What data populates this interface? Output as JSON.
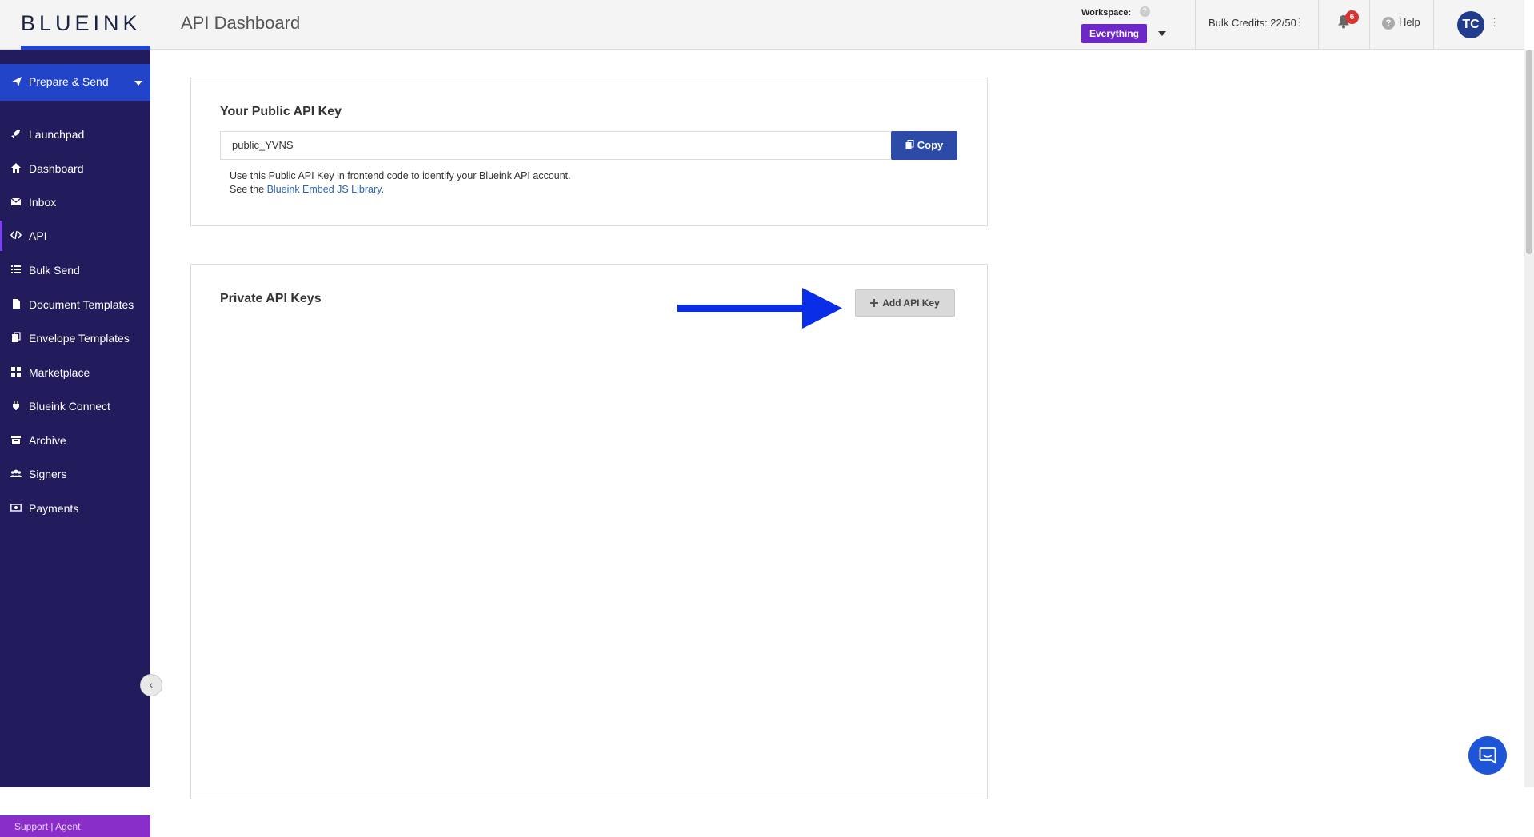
{
  "header": {
    "logo_text": "BLUEINK",
    "page_title": "API Dashboard",
    "workspace_label": "Workspace:",
    "workspace_value": "Everything",
    "bulk_credits": "Bulk Credits: 22/50",
    "notification_count": "6",
    "help_label": "Help",
    "avatar_initials": "TC"
  },
  "sidebar": {
    "prepare_label": "Prepare & Send",
    "items": [
      {
        "label": "Launchpad",
        "icon": "rocket-icon"
      },
      {
        "label": "Dashboard",
        "icon": "home-icon"
      },
      {
        "label": "Inbox",
        "icon": "envelope-icon"
      },
      {
        "label": "API",
        "icon": "code-icon"
      },
      {
        "label": "Bulk Send",
        "icon": "list-icon"
      },
      {
        "label": "Document Templates",
        "icon": "document-icon"
      },
      {
        "label": "Envelope Templates",
        "icon": "copy-icon"
      },
      {
        "label": "Marketplace",
        "icon": "grid-icon"
      },
      {
        "label": "Blueink Connect",
        "icon": "plug-icon"
      },
      {
        "label": "Archive",
        "icon": "archive-icon"
      },
      {
        "label": "Signers",
        "icon": "users-icon"
      },
      {
        "label": "Payments",
        "icon": "money-icon"
      }
    ],
    "support_text": "Support | Agent"
  },
  "public_key": {
    "title": "Your Public API Key",
    "value": "public_YVNS",
    "copy_label": "Copy",
    "desc_line1": "Use this Public API Key in frontend code to identify your Blueink API account.",
    "desc_line2_prefix": "See the ",
    "desc_link": "Blueink Embed JS Library",
    "desc_line2_suffix": "."
  },
  "private_keys": {
    "title": "Private API Keys",
    "add_label": "Add API Key"
  },
  "colors": {
    "sidebar_bg": "#231c5c",
    "prepare_bg": "#2144c9",
    "workspace_badge": "#6f28c8",
    "support_bar": "#8a2ec9",
    "annotation_arrow": "#0a2ee8"
  }
}
